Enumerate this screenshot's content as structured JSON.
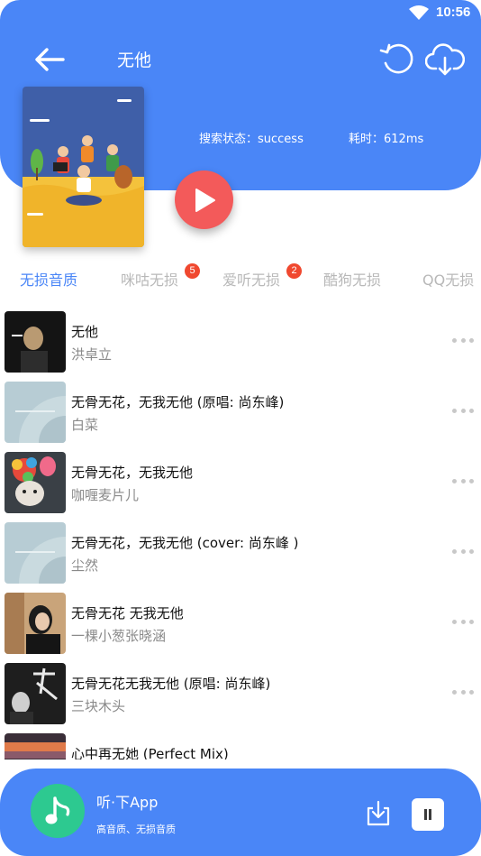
{
  "status_bar": {
    "time": "10:56",
    "wifi_icon": "wifi-icon"
  },
  "header": {
    "title": "无他",
    "search_status": "搜索状态：success",
    "elapsed": "耗时：612ms",
    "back_icon": "arrow-left-icon",
    "refresh_icon": "refresh-icon",
    "download_icon": "cloud-download-icon"
  },
  "play_icon": "play-icon",
  "tabs": [
    {
      "label": "无损音质",
      "active": true,
      "badge": ""
    },
    {
      "label": "咪咕无损",
      "active": false,
      "badge": "5"
    },
    {
      "label": "爱听无损",
      "active": false,
      "badge": "2"
    },
    {
      "label": "酷狗无损",
      "active": false,
      "badge": ""
    },
    {
      "label": "QQ无损",
      "active": false,
      "badge": ""
    }
  ],
  "songs": [
    {
      "title": "无他",
      "artist": "洪卓立"
    },
    {
      "title": "无骨无花，无我无他 (原唱: 尚东峰)",
      "artist": "白菜"
    },
    {
      "title": "无骨无花，无我无他",
      "artist": "咖喱麦片儿"
    },
    {
      "title": "无骨无花，无我无他 (cover: 尚东峰 )",
      "artist": "尘然"
    },
    {
      "title": "无骨无花 无我无他",
      "artist": "一棵小葱张晓涵"
    },
    {
      "title": "无骨无花无我无他 (原唱: 尚东峰)",
      "artist": "三块木头"
    },
    {
      "title": "心中再无她 (Perfect Mix)",
      "artist": ""
    }
  ],
  "player": {
    "app_name": "听·下App",
    "app_desc": "高音质、无损音质",
    "logo_icon": "music-note-icon",
    "download_icon": "download-icon",
    "pause_icon": "pause-icon"
  },
  "colors": {
    "primary": "#4a86f7",
    "play": "#f35a5a",
    "badge": "#f0482f",
    "logo": "#2dc990"
  }
}
